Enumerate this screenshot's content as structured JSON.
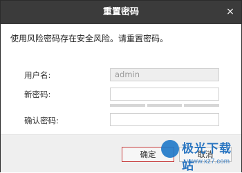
{
  "dialog": {
    "title": "重置密码",
    "close_glyph": "×"
  },
  "warning": "使用风险密码存在安全风险。请重置密码。",
  "form": {
    "username_label": "用户名:",
    "username_value": "admin",
    "new_password_label": "新密码:",
    "new_password_value": "",
    "confirm_password_label": "确认密码:",
    "confirm_password_value": ""
  },
  "buttons": {
    "confirm": "确定",
    "cancel": "取消"
  },
  "watermark": {
    "brand": "极光下载站",
    "url": "www.xz7.com"
  },
  "colors": {
    "titlebar": "#3b3b3b",
    "accent_border": "#c73c3c",
    "watermark": "#1f6fbf"
  }
}
